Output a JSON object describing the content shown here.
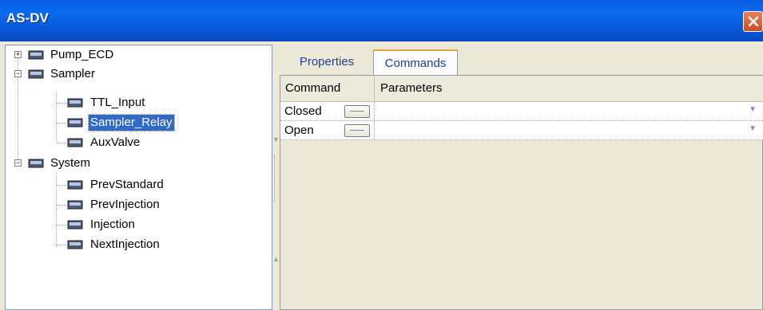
{
  "window": {
    "title": "AS-DV",
    "accent": "#0b62e4"
  },
  "tree": {
    "nodes": [
      {
        "label": "Pump_ECD",
        "expander": "+"
      },
      {
        "label": "Sampler",
        "expander": "−"
      },
      {
        "label": "TTL_Input"
      },
      {
        "label": "Sampler_Relay",
        "selected": true
      },
      {
        "label": "AuxValve"
      },
      {
        "label": "System",
        "expander": "−"
      },
      {
        "label": "PrevStandard"
      },
      {
        "label": "PrevInjection"
      },
      {
        "label": "Injection"
      },
      {
        "label": "NextInjection"
      }
    ]
  },
  "tabs": [
    {
      "label": "Properties"
    },
    {
      "label": "Commands",
      "active": true
    }
  ],
  "grid": {
    "headers": {
      "command": "Command",
      "parameters": "Parameters"
    },
    "rows": [
      {
        "command": "Closed",
        "parameters": ""
      },
      {
        "command": "Open",
        "parameters": ""
      }
    ]
  }
}
